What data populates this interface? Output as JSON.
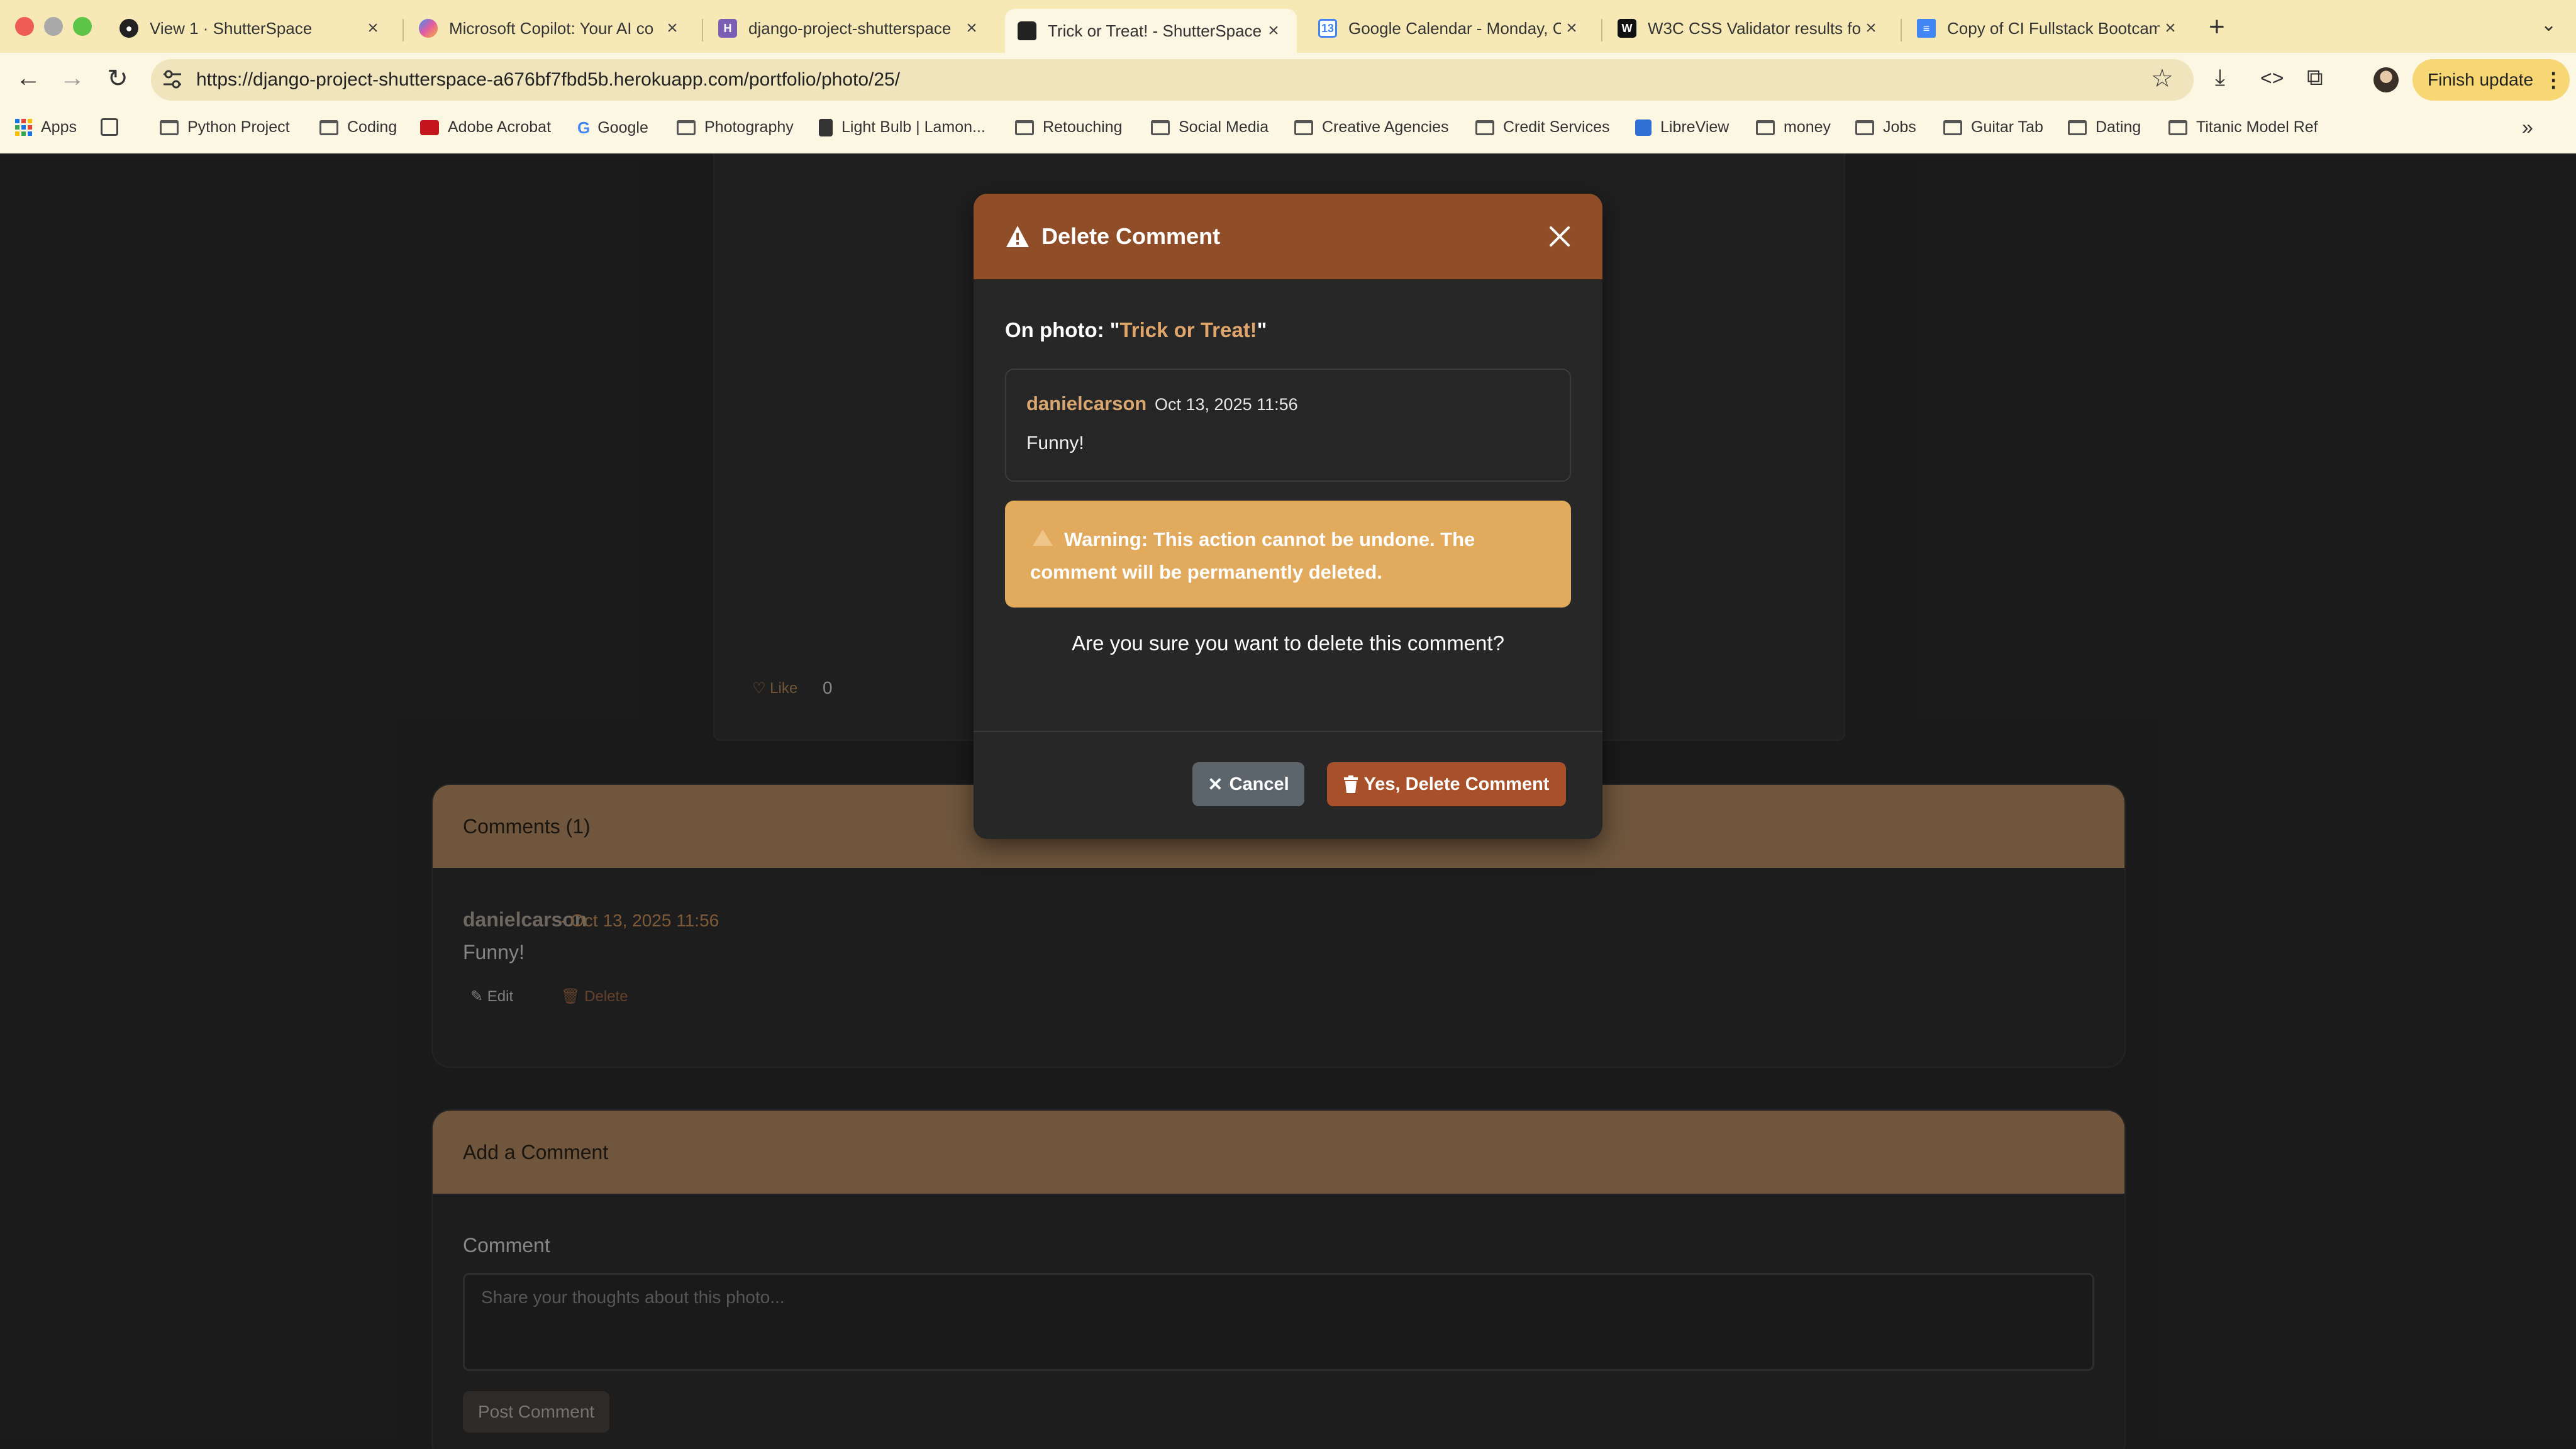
{
  "browser": {
    "tabs": [
      {
        "title": "View 1 · ShutterSpace",
        "icon": "github-icon"
      },
      {
        "title": "Microsoft Copilot: Your AI co",
        "icon": "copilot-icon"
      },
      {
        "title": "django-project-shutterspace",
        "icon": "heroku-icon"
      },
      {
        "title": "Trick or Treat! - ShutterSpace",
        "icon": "camera-icon",
        "active": true
      },
      {
        "title": "Google Calendar - Monday, C",
        "icon": "calendar-icon"
      },
      {
        "title": "W3C CSS Validator results fo",
        "icon": "w3c-icon"
      },
      {
        "title": "Copy of CI Fullstack Bootcam",
        "icon": "docs-icon"
      }
    ],
    "url": "https://django-project-shutterspace-a676bf7fbd5b.herokuapp.com/portfolio/photo/25/",
    "finish_update": "Finish update",
    "bookmarks": [
      {
        "label": "Apps",
        "icon": "apps-grid-icon"
      },
      {
        "label": "Python Project",
        "icon": "folder-icon"
      },
      {
        "label": "Coding",
        "icon": "folder-icon"
      },
      {
        "label": "Adobe Acrobat",
        "icon": "acrobat-icon"
      },
      {
        "label": "Google",
        "icon": "google-icon"
      },
      {
        "label": "Photography",
        "icon": "folder-icon"
      },
      {
        "label": "Light Bulb | Lamon...",
        "icon": "lightbulb-icon"
      },
      {
        "label": "Retouching",
        "icon": "folder-icon"
      },
      {
        "label": "Social Media",
        "icon": "folder-icon"
      },
      {
        "label": "Creative Agencies",
        "icon": "folder-icon"
      },
      {
        "label": "Credit Services",
        "icon": "folder-icon"
      },
      {
        "label": "LibreView",
        "icon": "libreview-icon"
      },
      {
        "label": "money",
        "icon": "folder-icon"
      },
      {
        "label": "Jobs",
        "icon": "folder-icon"
      },
      {
        "label": "Guitar Tab",
        "icon": "folder-icon"
      },
      {
        "label": "Dating",
        "icon": "folder-icon"
      },
      {
        "label": "Titanic Model Ref",
        "icon": "folder-icon"
      }
    ]
  },
  "photo": {
    "like_label": "♡ Like",
    "like_count": "0"
  },
  "comments": {
    "header": "Comments (1)",
    "items": [
      {
        "user": "danielcarson",
        "separator": "·",
        "date": "Oct 13, 2025 11:56",
        "text": "Funny!",
        "edit_label": "Edit",
        "delete_label": "Delete"
      }
    ]
  },
  "add_comment": {
    "header": "Add a Comment",
    "label": "Comment",
    "placeholder": "Share your thoughts about this photo...",
    "submit_label": "Post Comment"
  },
  "modal": {
    "title": "Delete Comment",
    "on_photo_prefix": "On photo: \"",
    "photo_title": "Trick or Treat!",
    "on_photo_suffix": "\"",
    "comment_user": "danielcarson",
    "comment_date": "Oct 13, 2025 11:56",
    "comment_text": "Funny!",
    "warning": "Warning: This action cannot be undone. The comment will be permanently deleted.",
    "question": "Are you sure you want to delete this comment?",
    "cancel_label": "Cancel",
    "confirm_label": "Yes, Delete Comment"
  },
  "colors": {
    "modal_header": "#904e28",
    "accent": "#e0a56b",
    "warning_bg": "#e2aa5c",
    "delete_button": "#a8502a",
    "cancel_button": "#5c646c",
    "panel_header": "#b38b63"
  }
}
